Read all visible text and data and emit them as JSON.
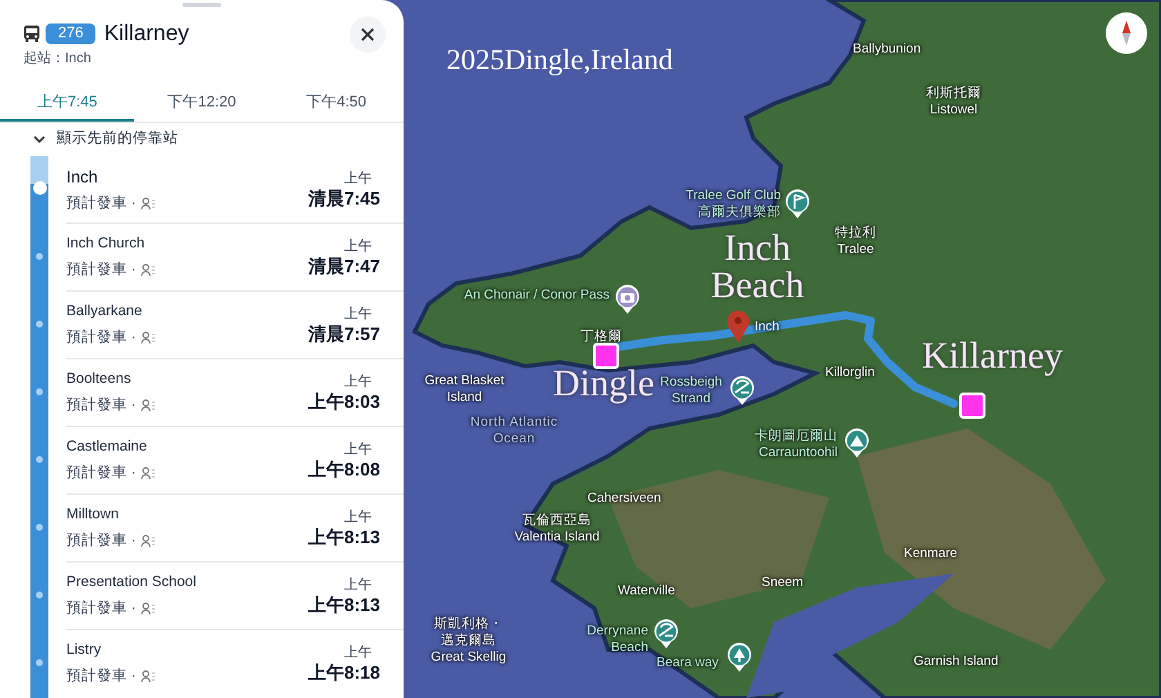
{
  "panel": {
    "route_number": "276",
    "destination": "Killarney",
    "origin": "起站：Inch",
    "tabs": [
      {
        "label": "上午7:45",
        "selected": true
      },
      {
        "label": "下午12:20",
        "selected": false
      },
      {
        "label": "下午4:50",
        "selected": false
      }
    ],
    "toggle": {
      "label": "顯示先前的停靠站",
      "expanded": false
    },
    "stops": [
      {
        "name": "Inch",
        "status": "預計發車 ·",
        "period": "上午",
        "time": "清晨7:45",
        "current": true
      },
      {
        "name": "Inch Church",
        "status": "預計發車 ·",
        "period": "上午",
        "time": "清晨7:47",
        "current": false
      },
      {
        "name": "Ballyarkane",
        "status": "預計發車 ·",
        "period": "上午",
        "time": "清晨7:57",
        "current": false
      },
      {
        "name": "Boolteens",
        "status": "預計發車 ·",
        "period": "上午",
        "time": "上午8:03",
        "current": false
      },
      {
        "name": "Castlemaine",
        "status": "預計發車 ·",
        "period": "上午",
        "time": "上午8:08",
        "current": false
      },
      {
        "name": "Milltown",
        "status": "預計發車 ·",
        "period": "上午",
        "time": "上午8:13",
        "current": false
      },
      {
        "name": "Presentation School",
        "status": "預計發車 ·",
        "period": "上午",
        "time": "上午8:13",
        "current": false
      },
      {
        "name": "Listry",
        "status": "預計發車 ·",
        "period": "上午",
        "time": "上午8:18",
        "current": false
      }
    ]
  },
  "map": {
    "title": "2025Dingle,Ireland",
    "annotations": [
      "Inch\nBeach",
      "Killarney",
      "Dingle"
    ],
    "labels": [
      {
        "kind": "town",
        "lines": [
          "Ballybunion"
        ]
      },
      {
        "kind": "town",
        "lines": [
          "利斯托爾",
          "Listowel"
        ]
      },
      {
        "kind": "poi",
        "lines": [
          "Tralee Golf Club",
          "高爾夫俱樂部"
        ]
      },
      {
        "kind": "town",
        "lines": [
          "特拉利",
          "Tralee"
        ]
      },
      {
        "kind": "poi",
        "lines": [
          "An Chonair / Conor Pass"
        ]
      },
      {
        "kind": "town",
        "lines": [
          "丁格爾"
        ]
      },
      {
        "kind": "town",
        "lines": [
          "Inch"
        ]
      },
      {
        "kind": "town",
        "lines": [
          "Great Blasket",
          "Island"
        ]
      },
      {
        "kind": "poi",
        "lines": [
          "Rossbeigh",
          "Strand"
        ]
      },
      {
        "kind": "town",
        "lines": [
          "Killorglin"
        ]
      },
      {
        "kind": "water",
        "lines": [
          "North Atlantic",
          "Ocean"
        ]
      },
      {
        "kind": "poi",
        "lines": [
          "卡朗圖厄爾山",
          "Carrauntoohil"
        ]
      },
      {
        "kind": "town",
        "lines": [
          "Cahersiveen"
        ]
      },
      {
        "kind": "town",
        "lines": [
          "瓦倫西亞島",
          "Valentia Island"
        ]
      },
      {
        "kind": "town",
        "lines": [
          "Kenmare"
        ]
      },
      {
        "kind": "town",
        "lines": [
          "Sneem"
        ]
      },
      {
        "kind": "town",
        "lines": [
          "Waterville"
        ]
      },
      {
        "kind": "town",
        "lines": [
          "斯凱利格・",
          "邁克爾島",
          "Great Skellig"
        ]
      },
      {
        "kind": "poi",
        "lines": [
          "Derrynane",
          "Beach"
        ]
      },
      {
        "kind": "poi",
        "lines": [
          "Beara way"
        ]
      },
      {
        "kind": "town",
        "lines": [
          "Garnish Island"
        ]
      }
    ]
  }
}
